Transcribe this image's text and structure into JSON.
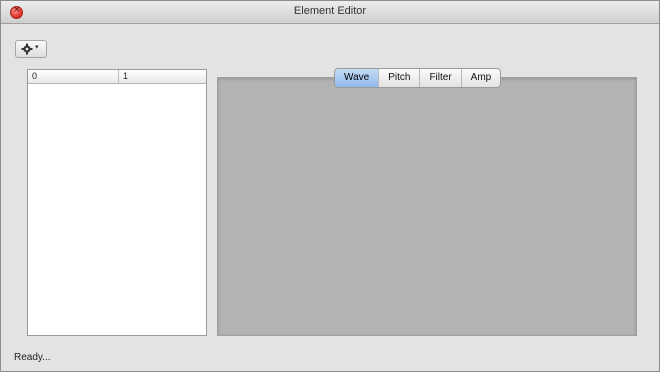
{
  "window": {
    "title": "Element Editor"
  },
  "toolbar": {
    "gear_icon": "gear-icon",
    "caret": "▾"
  },
  "list": {
    "columns": [
      "0",
      "1"
    ]
  },
  "tabs": [
    {
      "label": "Wave",
      "active": true
    },
    {
      "label": "Pitch",
      "active": false
    },
    {
      "label": "Filter",
      "active": false
    },
    {
      "label": "Amp",
      "active": false
    }
  ],
  "status": {
    "text": "Ready..."
  },
  "colors": {
    "active_tab": "#a9cdf2",
    "panel": "#b3b3b3",
    "close": "#d92b22"
  }
}
